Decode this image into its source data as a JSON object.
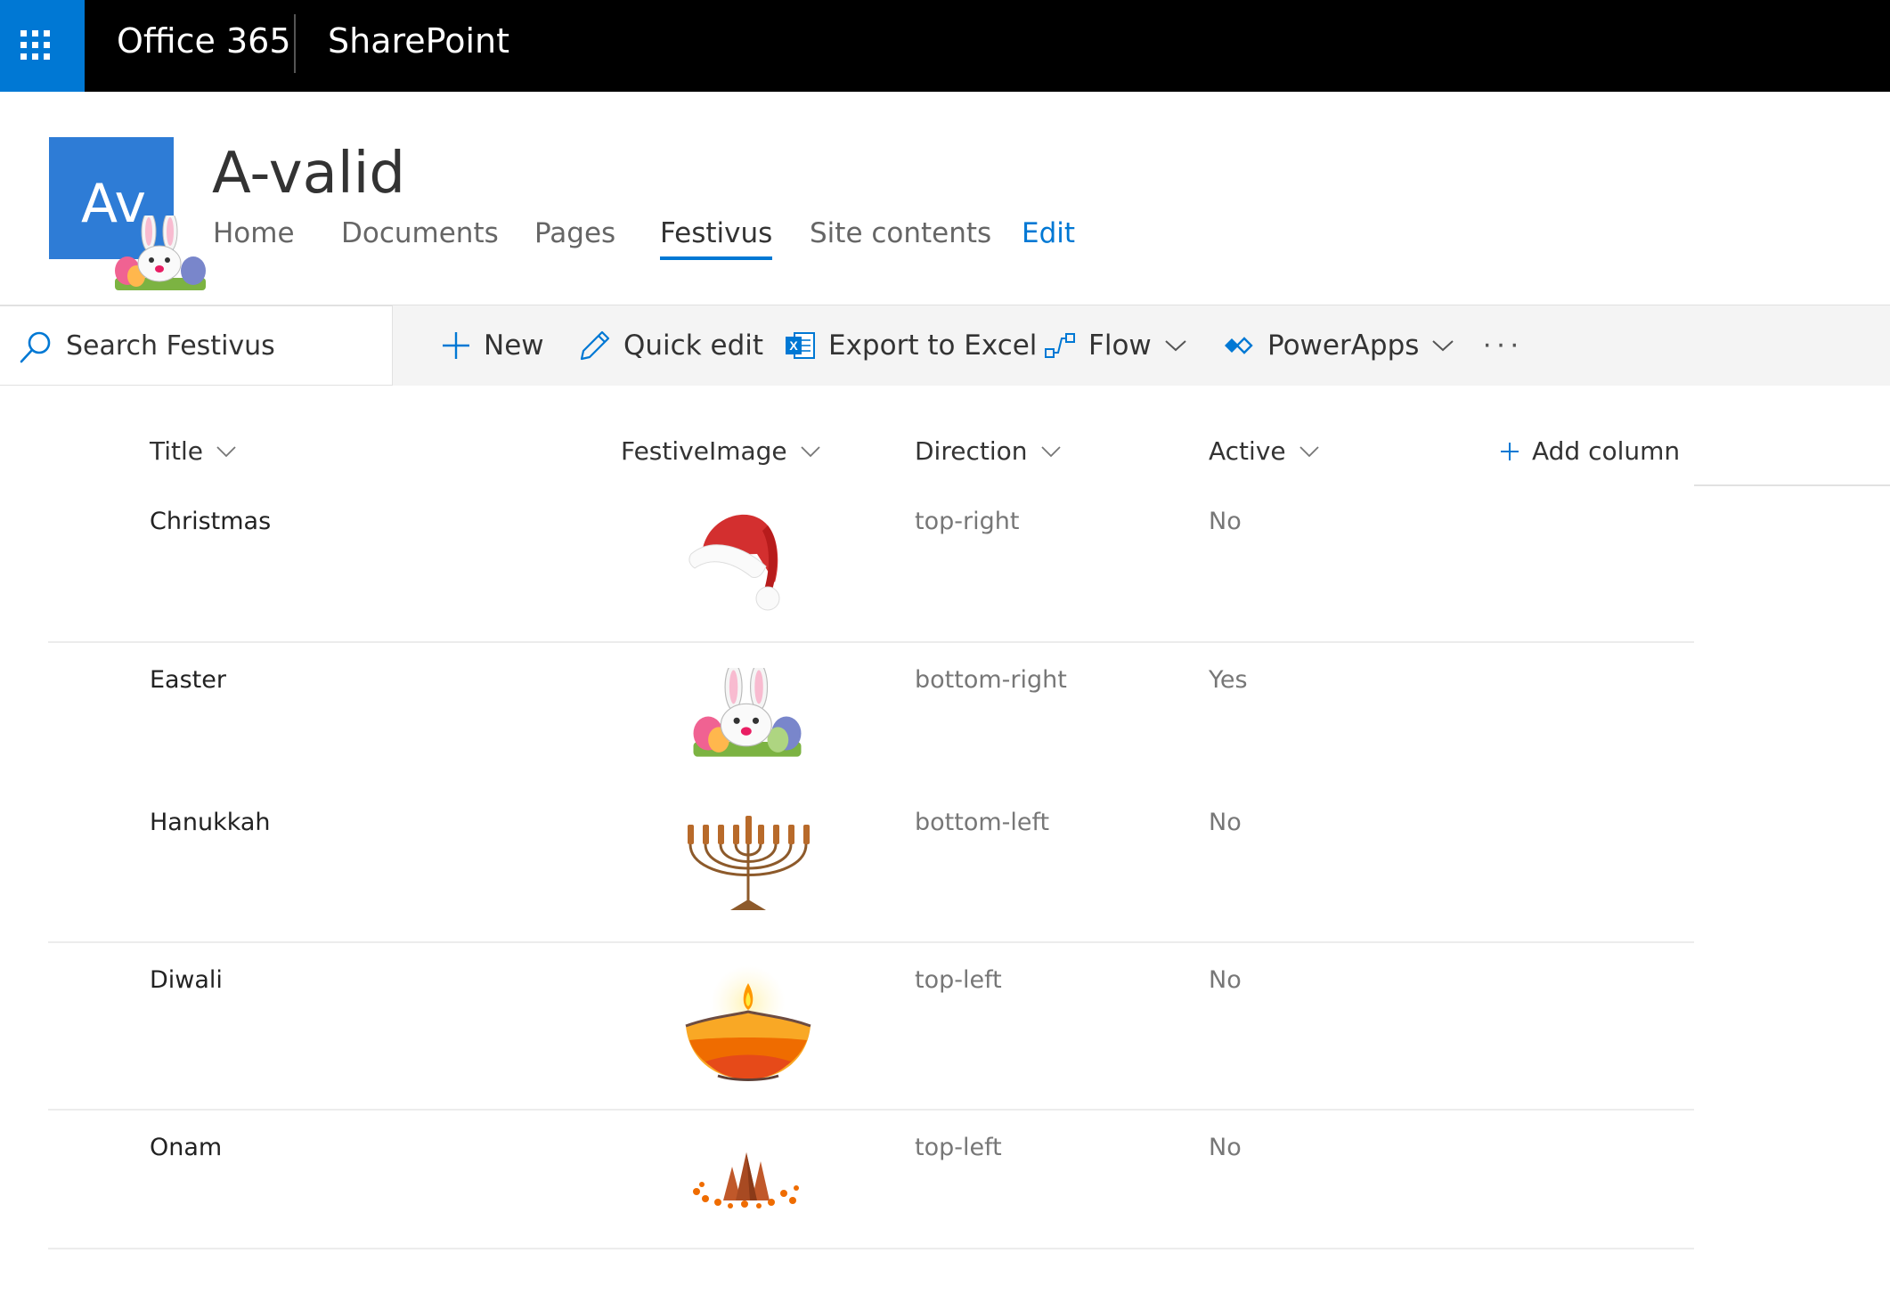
{
  "suite": {
    "brand": "Office 365",
    "app": "SharePoint"
  },
  "site": {
    "logo_text": "Av",
    "title": "A-valid"
  },
  "nav": [
    {
      "label": "Home"
    },
    {
      "label": "Documents"
    },
    {
      "label": "Pages"
    },
    {
      "label": "Festivus",
      "selected": true
    },
    {
      "label": "Site contents"
    },
    {
      "label": "Edit"
    }
  ],
  "search": {
    "placeholder": "Search Festivus"
  },
  "commands": {
    "new": "New",
    "quick_edit": "Quick edit",
    "export": "Export to Excel",
    "flow": "Flow",
    "powerapps": "PowerApps",
    "more": "···"
  },
  "columns": {
    "title": "Title",
    "image": "FestiveImage",
    "direction": "Direction",
    "active": "Active",
    "add": "Add column"
  },
  "rows": [
    {
      "title": "Christmas",
      "image": "santa-hat-icon",
      "direction": "top-right",
      "active": "No"
    },
    {
      "title": "Easter",
      "image": "easter-bunny-icon",
      "direction": "bottom-right",
      "active": "Yes"
    },
    {
      "title": "Hanukkah",
      "image": "menorah-icon",
      "direction": "bottom-left",
      "active": "No"
    },
    {
      "title": "Diwali",
      "image": "diya-lamp-icon",
      "direction": "top-left",
      "active": "No"
    },
    {
      "title": "Onam",
      "image": "onam-pookalam-icon",
      "direction": "top-left",
      "active": "No"
    }
  ],
  "colors": {
    "accent": "#0078d4",
    "logo": "#2e7cd6",
    "suitebar": "#000000"
  }
}
